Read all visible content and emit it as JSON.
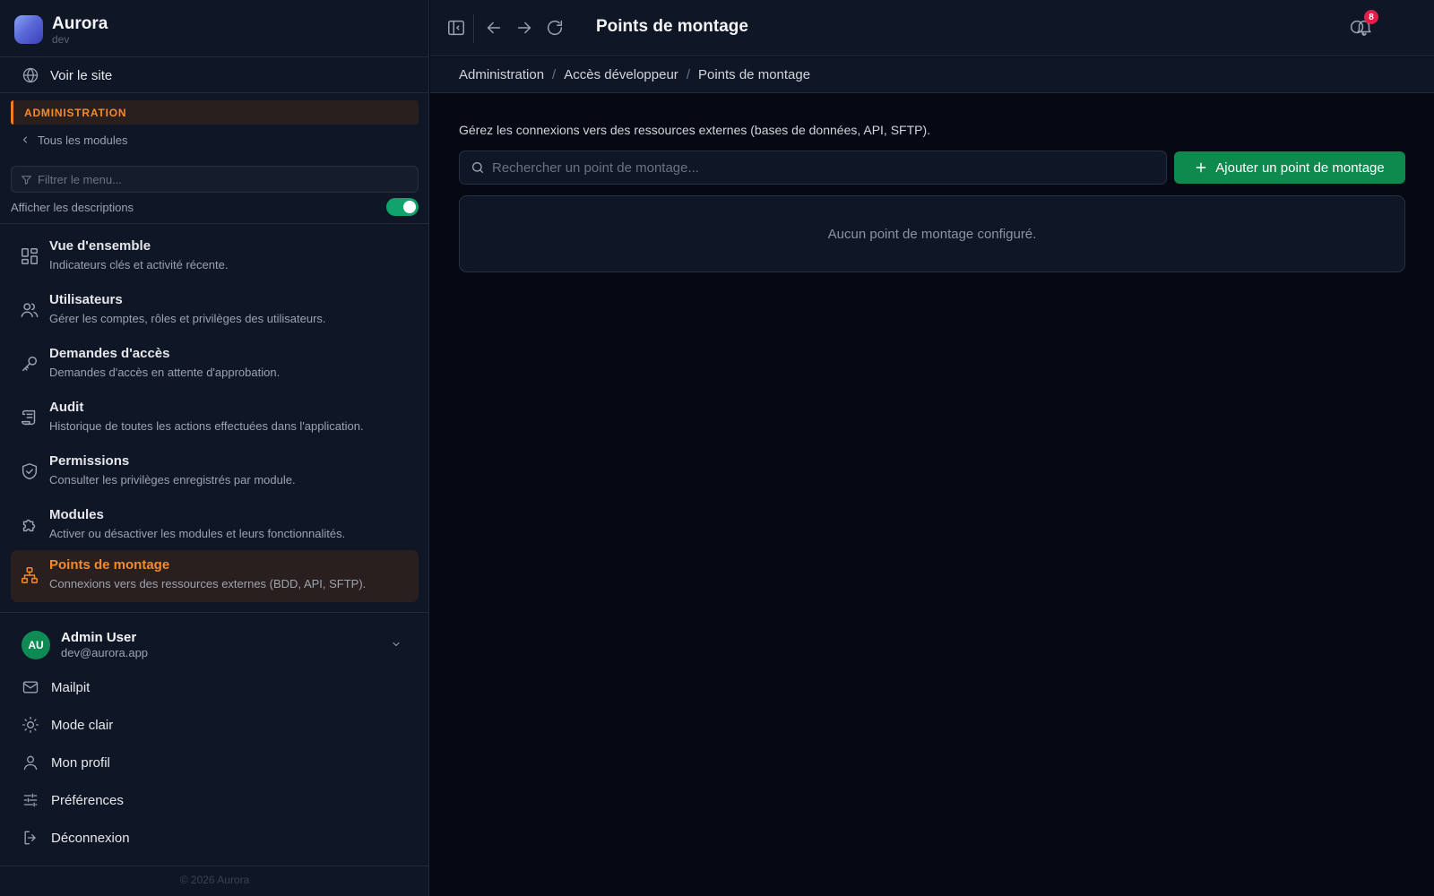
{
  "brand": {
    "name": "Aurora",
    "env": "dev"
  },
  "sidebar": {
    "view_site": "Voir le site",
    "section": "ADMINISTRATION",
    "all_modules": "Tous les modules",
    "filter_placeholder": "Filtrer le menu...",
    "show_descriptions": "Afficher les descriptions",
    "show_descriptions_on": true,
    "items": [
      {
        "title": "Vue d'ensemble",
        "desc": "Indicateurs clés et activité récente.",
        "icon": "dashboard-icon"
      },
      {
        "title": "Utilisateurs",
        "desc": "Gérer les comptes, rôles et privilèges des utilisateurs.",
        "icon": "users-icon"
      },
      {
        "title": "Demandes d'accès",
        "desc": "Demandes d'accès en attente d'approbation.",
        "icon": "key-icon"
      },
      {
        "title": "Audit",
        "desc": "Historique de toutes les actions effectuées dans l'application.",
        "icon": "scroll-icon"
      },
      {
        "title": "Permissions",
        "desc": "Consulter les privilèges enregistrés par module.",
        "icon": "shield-icon"
      },
      {
        "title": "Modules",
        "desc": "Activer ou désactiver les modules et leurs fonctionnalités.",
        "icon": "puzzle-icon"
      },
      {
        "title": "Points de montage",
        "desc": "Connexions vers des ressources externes (BDD, API, SFTP).",
        "icon": "network-icon",
        "active": true
      }
    ],
    "user": {
      "initials": "AU",
      "name": "Admin User",
      "email": "dev@aurora.app"
    },
    "bottom": [
      {
        "label": "Mailpit",
        "icon": "mail-icon"
      },
      {
        "label": "Mode clair",
        "icon": "sun-icon"
      },
      {
        "label": "Mon profil",
        "icon": "user-icon"
      },
      {
        "label": "Préférences",
        "icon": "sliders-icon"
      },
      {
        "label": "Déconnexion",
        "icon": "logout-icon"
      }
    ],
    "copyright": "© 2026 Aurora"
  },
  "topbar": {
    "title": "Points de montage",
    "notifications": "8"
  },
  "breadcrumb": [
    "Administration",
    "Accès développeur",
    "Points de montage"
  ],
  "main": {
    "intro": "Gérez les connexions vers des ressources externes (bases de données, API, SFTP).",
    "search_placeholder": "Rechercher un point de montage...",
    "add_button": "Ajouter un point de montage",
    "empty": "Aucun point de montage configuré."
  },
  "colors": {
    "accent": "#f28a2e",
    "primary_green": "#0e8a4f",
    "badge": "#e11d48"
  }
}
